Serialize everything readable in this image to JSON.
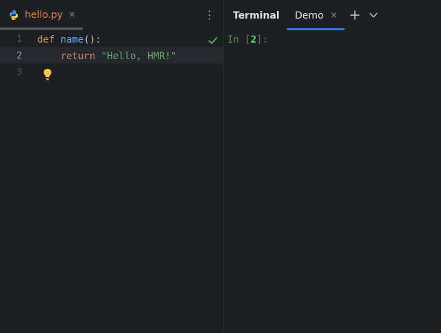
{
  "editor": {
    "tab": {
      "filename": "hello.py",
      "close_glyph": "×",
      "icon": "python-icon"
    },
    "more_glyph": "⋮",
    "line_numbers": [
      "1",
      "2",
      "3"
    ],
    "code": {
      "line1": {
        "keyword": "def",
        "space": " ",
        "function": "name",
        "rest": "():"
      },
      "line2": {
        "indent": "    ",
        "keyword": "return",
        "space": " ",
        "string": "\"Hello, HMR!\""
      }
    },
    "icons": {
      "lightbulb": "lightbulb-icon",
      "check": "checkmark-icon"
    }
  },
  "terminal": {
    "title": "Terminal",
    "tab": {
      "label": "Demo",
      "close_glyph": "×"
    },
    "prompt": {
      "prefix": "In [",
      "number": "2",
      "suffix": "]:"
    },
    "icons": {
      "add": "plus-icon",
      "dropdown": "chevron-down-icon"
    }
  },
  "colors": {
    "background": "#1e1f22",
    "keyword": "#cf8e6d",
    "function": "#56a8f5",
    "string": "#6aab73",
    "filename": "#e0864f",
    "accent": "#3574f0",
    "prompt": "#4b8a47"
  }
}
